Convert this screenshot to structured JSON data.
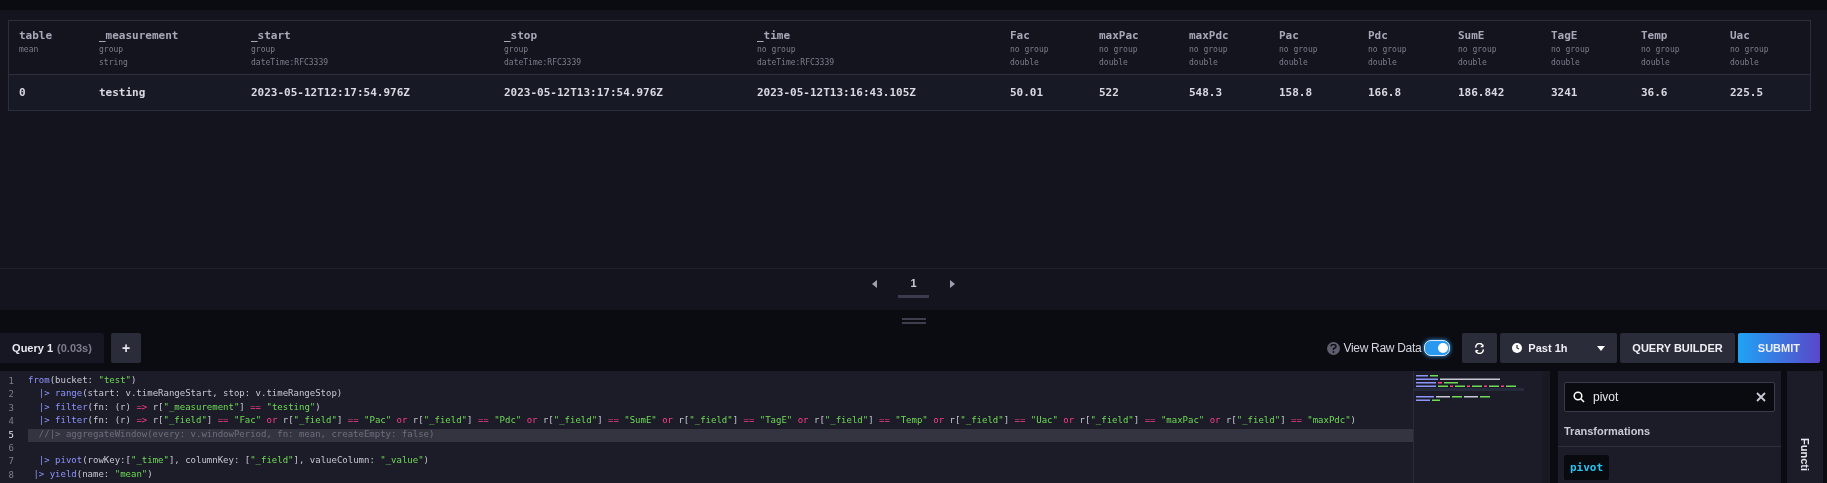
{
  "table": {
    "columns": [
      {
        "name": "table",
        "meta": [
          "mean"
        ]
      },
      {
        "name": "_measurement",
        "meta": [
          "group",
          "string"
        ]
      },
      {
        "name": "_start",
        "meta": [
          "group",
          "dateTime:RFC3339"
        ]
      },
      {
        "name": "_stop",
        "meta": [
          "group",
          "dateTime:RFC3339"
        ]
      },
      {
        "name": "_time",
        "meta": [
          "no group",
          "dateTime:RFC3339"
        ]
      },
      {
        "name": "Fac",
        "meta": [
          "no group",
          "double"
        ]
      },
      {
        "name": "maxPac",
        "meta": [
          "no group",
          "double"
        ]
      },
      {
        "name": "maxPdc",
        "meta": [
          "no group",
          "double"
        ]
      },
      {
        "name": "Pac",
        "meta": [
          "no group",
          "double"
        ]
      },
      {
        "name": "Pdc",
        "meta": [
          "no group",
          "double"
        ]
      },
      {
        "name": "SumE",
        "meta": [
          "no group",
          "double"
        ]
      },
      {
        "name": "TagE",
        "meta": [
          "no group",
          "double"
        ]
      },
      {
        "name": "Temp",
        "meta": [
          "no group",
          "double"
        ]
      },
      {
        "name": "Uac",
        "meta": [
          "no group",
          "double"
        ]
      }
    ],
    "rows": [
      [
        "0",
        "testing",
        "2023-05-12T12:17:54.976Z",
        "2023-05-12T13:17:54.976Z",
        "2023-05-12T13:16:43.105Z",
        "50.01",
        "522",
        "548.3",
        "158.8",
        "166.8",
        "186.842",
        "3241",
        "36.6",
        "225.5"
      ]
    ]
  },
  "pagination": {
    "pages": [
      {
        "label": "1",
        "selected": true
      }
    ]
  },
  "query_tabs": [
    {
      "label": "Query 1",
      "time": "(0.03s)",
      "selected": true
    }
  ],
  "add_tab": "+",
  "toolbar": {
    "view_raw_data": {
      "label": "View Raw Data",
      "on": true
    },
    "time_range": "Past 1h",
    "query_builder": "QUERY BUILDER",
    "submit": "SUBMIT"
  },
  "editor": {
    "lines": [
      {
        "number": "1",
        "current": false,
        "tokens": [
          {
            "kind": "fn",
            "text": "from"
          },
          {
            "kind": "plain",
            "text": "(bucket: "
          },
          {
            "kind": "str",
            "text": "\"test\""
          },
          {
            "kind": "plain",
            "text": ")"
          }
        ]
      },
      {
        "number": "2",
        "current": false,
        "tokens": [
          {
            "kind": "fn",
            "text": "  |> range"
          },
          {
            "kind": "plain",
            "text": "(start: v.timeRangeStart, stop: v.timeRangeStop)"
          }
        ]
      },
      {
        "number": "3",
        "current": false,
        "tokens": [
          {
            "kind": "fn",
            "text": "  |> filter"
          },
          {
            "kind": "plain",
            "text": "(fn: (r) "
          },
          {
            "kind": "op",
            "text": "=>"
          },
          {
            "kind": "plain",
            "text": " r["
          },
          {
            "kind": "str",
            "text": "\"_measurement\""
          },
          {
            "kind": "plain",
            "text": "] "
          },
          {
            "kind": "op",
            "text": "=="
          },
          {
            "kind": "str",
            "text": " \"testing\""
          },
          {
            "kind": "plain",
            "text": ")"
          }
        ]
      },
      {
        "number": "4",
        "current": false,
        "tokens": [
          {
            "kind": "fn",
            "text": "  |> filter"
          },
          {
            "kind": "plain",
            "text": "(fn: (r) "
          },
          {
            "kind": "op",
            "text": "=>"
          },
          {
            "kind": "plain",
            "text": " r["
          },
          {
            "kind": "str",
            "text": "\"_field\""
          },
          {
            "kind": "plain",
            "text": "] "
          },
          {
            "kind": "op",
            "text": "=="
          },
          {
            "kind": "str",
            "text": " \"Fac\""
          },
          {
            "kind": "op",
            "text": " or"
          },
          {
            "kind": "plain",
            "text": " r["
          },
          {
            "kind": "str",
            "text": "\"_field\""
          },
          {
            "kind": "plain",
            "text": "] "
          },
          {
            "kind": "op",
            "text": "=="
          },
          {
            "kind": "str",
            "text": " \"Pac\""
          },
          {
            "kind": "op",
            "text": " or"
          },
          {
            "kind": "plain",
            "text": " r["
          },
          {
            "kind": "str",
            "text": "\"_field\""
          },
          {
            "kind": "plain",
            "text": "] "
          },
          {
            "kind": "op",
            "text": "=="
          },
          {
            "kind": "str",
            "text": " \"Pdc\""
          },
          {
            "kind": "op",
            "text": " or"
          },
          {
            "kind": "plain",
            "text": " r["
          },
          {
            "kind": "str",
            "text": "\"_field\""
          },
          {
            "kind": "plain",
            "text": "] "
          },
          {
            "kind": "op",
            "text": "=="
          },
          {
            "kind": "str",
            "text": " \"SumE\""
          },
          {
            "kind": "op",
            "text": " or"
          },
          {
            "kind": "plain",
            "text": " r["
          },
          {
            "kind": "str",
            "text": "\"_field\""
          },
          {
            "kind": "plain",
            "text": "] "
          },
          {
            "kind": "op",
            "text": "=="
          },
          {
            "kind": "str",
            "text": " \"TagE\""
          },
          {
            "kind": "op",
            "text": " or"
          },
          {
            "kind": "plain",
            "text": " r["
          },
          {
            "kind": "str",
            "text": "\"_field\""
          },
          {
            "kind": "plain",
            "text": "] "
          },
          {
            "kind": "op",
            "text": "=="
          },
          {
            "kind": "str",
            "text": " \"Temp\""
          },
          {
            "kind": "op",
            "text": " or"
          },
          {
            "kind": "plain",
            "text": " r["
          },
          {
            "kind": "str",
            "text": "\"_field\""
          },
          {
            "kind": "plain",
            "text": "] "
          },
          {
            "kind": "op",
            "text": "=="
          },
          {
            "kind": "str",
            "text": " \"Uac\""
          },
          {
            "kind": "op",
            "text": " or"
          },
          {
            "kind": "plain",
            "text": " r["
          },
          {
            "kind": "str",
            "text": "\"_field\""
          },
          {
            "kind": "plain",
            "text": "] "
          },
          {
            "kind": "op",
            "text": "=="
          },
          {
            "kind": "str",
            "text": " \"maxPac\""
          },
          {
            "kind": "op",
            "text": " or"
          },
          {
            "kind": "plain",
            "text": " r["
          },
          {
            "kind": "str",
            "text": "\"_field\""
          },
          {
            "kind": "plain",
            "text": "] "
          },
          {
            "kind": "op",
            "text": "=="
          },
          {
            "kind": "str",
            "text": " \"maxPdc\""
          },
          {
            "kind": "plain",
            "text": ")"
          }
        ]
      },
      {
        "number": "5",
        "current": true,
        "tokens": [
          {
            "kind": "comment",
            "text": "  //|> aggregateWindow(every: v.windowPeriod, fn: mean, createEmpty: false)"
          }
        ]
      },
      {
        "number": "6",
        "current": false
      },
      {
        "number": "7",
        "current": false,
        "tokens": [
          {
            "kind": "fn",
            "text": "  |> pivot"
          },
          {
            "kind": "plain",
            "text": "(rowKey:["
          },
          {
            "kind": "str",
            "text": "\"_time\""
          },
          {
            "kind": "plain",
            "text": "], columnKey: ["
          },
          {
            "kind": "str",
            "text": "\"_field\""
          },
          {
            "kind": "plain",
            "text": "], valueColumn: "
          },
          {
            "kind": "str",
            "text": "\"_value\""
          },
          {
            "kind": "plain",
            "text": ")"
          }
        ]
      },
      {
        "number": "8",
        "current": false,
        "tokens": [
          {
            "kind": "fn",
            "text": " |> yield"
          },
          {
            "kind": "plain",
            "text": "(name: "
          },
          {
            "kind": "str",
            "text": "\"mean\""
          },
          {
            "kind": "plain",
            "text": ")"
          }
        ]
      }
    ]
  },
  "functions": {
    "search": {
      "value": "pivot"
    },
    "section": "Transformations",
    "items": [
      "pivot"
    ],
    "side_tab": "Functi"
  }
}
